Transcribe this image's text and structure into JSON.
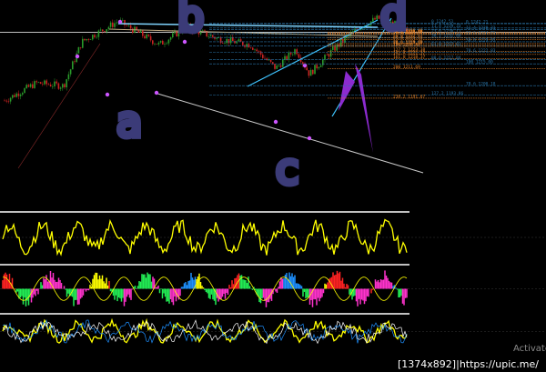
{
  "chart_data": {
    "type": "line",
    "main": {
      "type": "candlestick",
      "ylim": [
        1115,
        1246
      ],
      "price_line_level": 1236.5,
      "price_line_color": "#ffffff",
      "grid": false,
      "colors": {
        "up": "#2a9a2a",
        "down": "#cc2222",
        "marker": "#cc55ff"
      }
    },
    "fib_levels": [
      {
        "label": "0 1242.51",
        "price": 1242.51,
        "color": "#2a75a8"
      },
      {
        "label": "0 1242.21",
        "price": 1242.21,
        "color": "#2a75a8"
      },
      {
        "label": "11.4 1239.33",
        "price": 1239.33,
        "color": "#2a75a8"
      },
      {
        "label": "11.4 1238.31",
        "price": 1238.31,
        "color": "#2a75a8"
      },
      {
        "label": "23.6 1236.11",
        "price": 1236.11,
        "color": "#2a75a8"
      },
      {
        "label": "23.6 1234.96",
        "price": 1234.96,
        "color": "#2a75a8"
      },
      {
        "label": "23.6 1236.46",
        "price": 1236.46,
        "color": "#e0802a"
      },
      {
        "label": "11.8 1235.83",
        "price": 1235.83,
        "color": "#e0802a"
      },
      {
        "label": "23.6 1235.55",
        "price": 1235.55,
        "color": "#e0802a"
      },
      {
        "label": "38.2 1234.99",
        "price": 1234.99,
        "color": "#e0802a"
      },
      {
        "label": "38.2 1232.89",
        "price": 1232.89,
        "color": "#2a75a8"
      },
      {
        "label": "50.0 1232.57",
        "price": 1232.57,
        "color": "#e0802a"
      },
      {
        "label": "61.8 1231.53",
        "price": 1231.53,
        "color": "#e0802a"
      },
      {
        "label": "50.0 1229.95",
        "price": 1229.95,
        "color": "#2a75a8"
      },
      {
        "label": "78.6 1228.79",
        "price": 1228.79,
        "color": "#e0802a"
      },
      {
        "label": "88.6 1227.90",
        "price": 1227.9,
        "color": "#e0802a"
      },
      {
        "label": "61.8 1227.01",
        "price": 1227.01,
        "color": "#2a75a8"
      },
      {
        "label": "100 1226.80",
        "price": 1226.8,
        "color": "#e0802a"
      },
      {
        "label": "127.2 1223.38",
        "price": 1223.38,
        "color": "#e0802a"
      },
      {
        "label": "78.6 1222.83",
        "price": 1222.83,
        "color": "#2a75a8"
      },
      {
        "label": "141.4 1221.37",
        "price": 1221.37,
        "color": "#e0802a"
      },
      {
        "label": "161.8 1218.37",
        "price": 1218.37,
        "color": "#e0802a"
      },
      {
        "label": "88.6 1217.84",
        "price": 1217.84,
        "color": "#2a75a8"
      },
      {
        "label": "100 1215.00",
        "price": 1215.0,
        "color": "#2a75a8"
      },
      {
        "label": "200 1211.69",
        "price": 1211.69,
        "color": "#e0802a"
      },
      {
        "label": "78.6 1200.18",
        "price": 1200.18,
        "color": "#2a75a8"
      },
      {
        "label": "127.2 1193.86",
        "price": 1193.86,
        "color": "#2a75a8"
      },
      {
        "label": "238.2 1191.67",
        "price": 1191.67,
        "color": "#e0802a"
      }
    ],
    "wave_labels": [
      "b",
      "d",
      "a",
      "c"
    ],
    "oscillators": [
      {
        "type": "line",
        "name": "",
        "ylim": [
          -1,
          1
        ],
        "colors": [
          "#ffff00"
        ]
      },
      {
        "type": "area",
        "name": "",
        "ylim": [
          -1,
          1
        ],
        "colors": [
          "#ff2222",
          "#22ee55",
          "#ff33cc",
          "#1e90ff",
          "#ffff00"
        ]
      },
      {
        "type": "line",
        "name": "",
        "ylim": [
          -1,
          1
        ],
        "colors": [
          "#ffff00",
          "#1e90ff",
          "#ffffff"
        ]
      }
    ]
  },
  "footer": {
    "resolution": "[1374x892]",
    "separator": "|",
    "url": "https://upic.me/"
  },
  "watermark": "Activate"
}
